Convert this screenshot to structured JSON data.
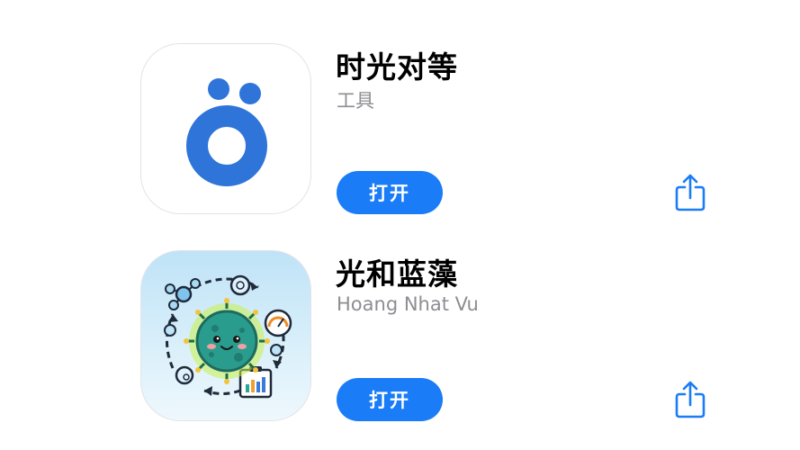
{
  "apps": [
    {
      "name": "时光对等",
      "subtitle": "工具",
      "open_label": "打开",
      "icon": "blue-o-with-dots-icon",
      "icon_color": "#2f74d8"
    },
    {
      "name": "光和蓝藻",
      "subtitle": "Hoang Nhat Vu",
      "open_label": "打开",
      "icon": "cyanobacteria-cycle-icon",
      "icon_color": "#2aa39a"
    }
  ],
  "colors": {
    "accent": "#1a7cf6",
    "subtitle": "#8e8e93"
  },
  "share_icon": "share-icon"
}
